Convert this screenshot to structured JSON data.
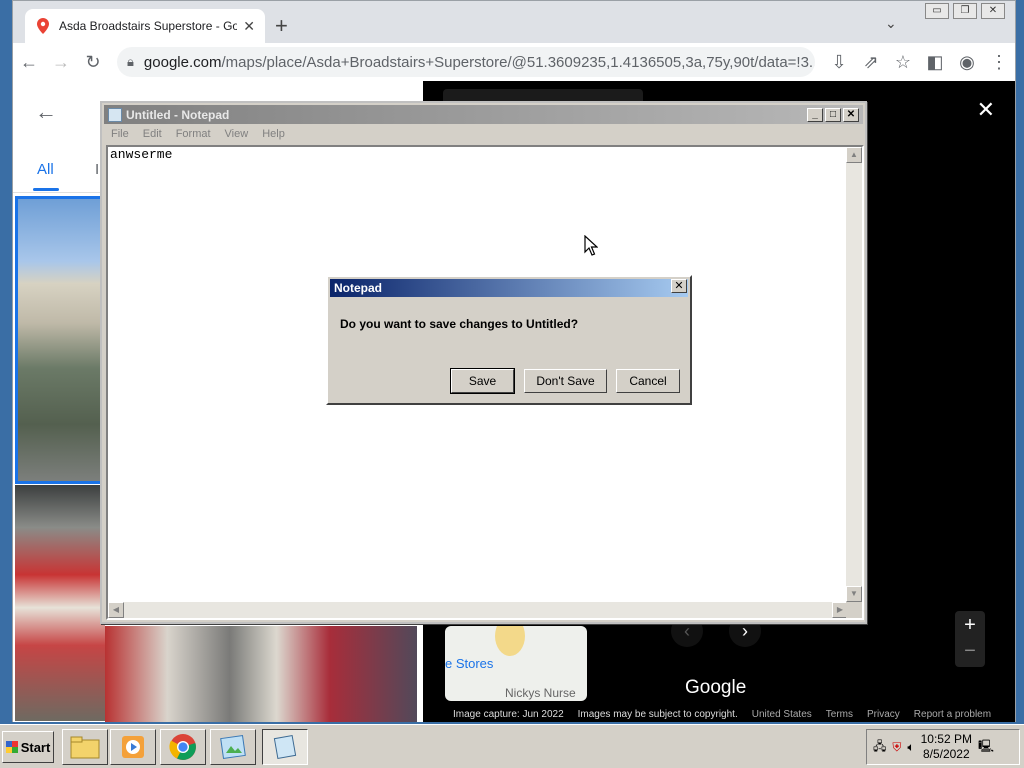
{
  "browser": {
    "tab_title": "Asda Broadstairs Superstore - Goog",
    "url_domain": "google.com",
    "url_path": "/maps/place/Asda+Broadstairs+Superstore/@51.3609235,1.4136505,3a,75y,90t/data=!3..."
  },
  "maps": {
    "tab_all": "All",
    "tab_in": "I",
    "minimap_label": "e Stores",
    "minimap_label2": "Nickys Nurse",
    "logo": "Google",
    "footer": {
      "capture": "Image capture: Jun 2022",
      "copyright": "Images may be subject to copyright.",
      "country": "United States",
      "terms": "Terms",
      "privacy": "Privacy",
      "report": "Report a problem"
    }
  },
  "notepad": {
    "title": "Untitled - Notepad",
    "menu": [
      "File",
      "Edit",
      "Format",
      "View",
      "Help"
    ],
    "content": "anwserme"
  },
  "dialog": {
    "title": "Notepad",
    "message": "Do you want to save changes to Untitled?",
    "save": "Save",
    "dont_save": "Don't Save",
    "cancel": "Cancel"
  },
  "taskbar": {
    "start": "Start",
    "time": "10:52 PM",
    "date": "8/5/2022"
  }
}
